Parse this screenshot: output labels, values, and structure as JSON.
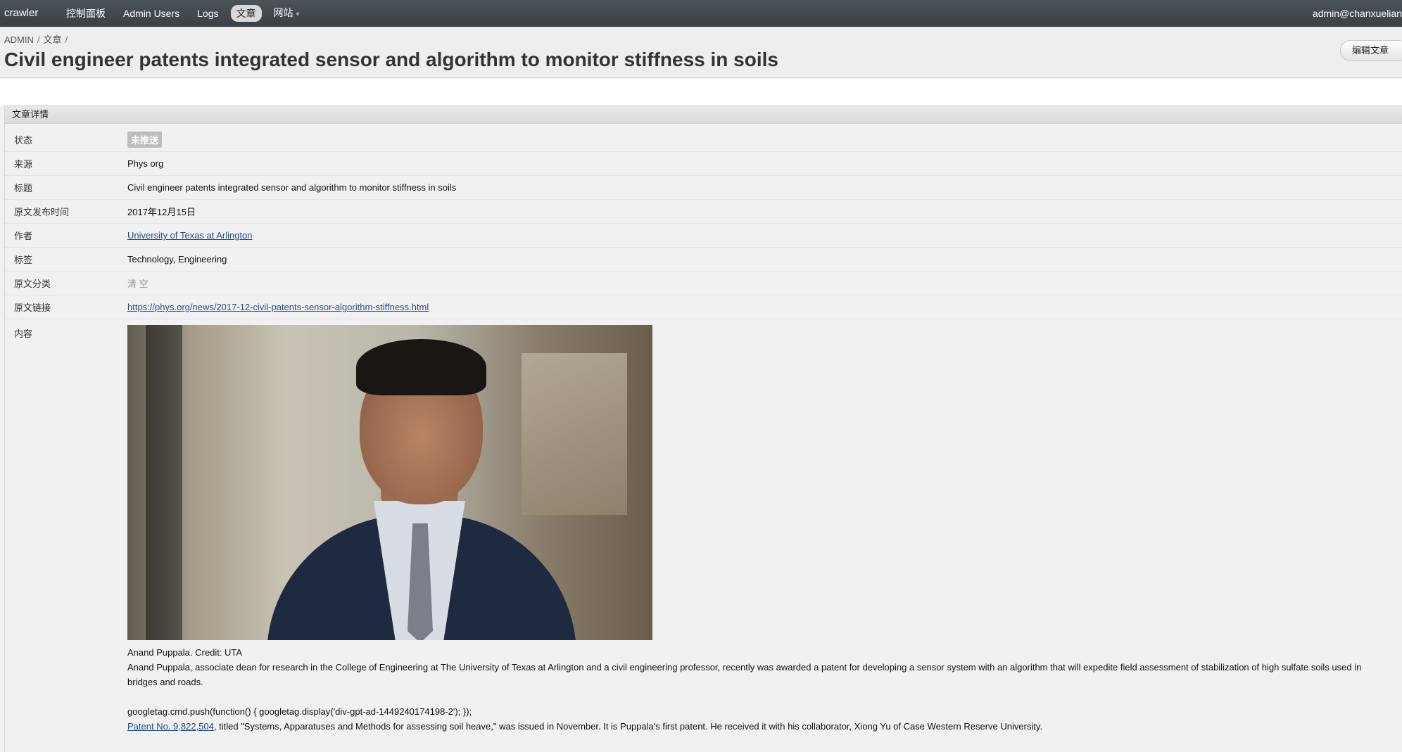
{
  "topbar": {
    "brand": "crawler",
    "nav": [
      {
        "label": "控制面板"
      },
      {
        "label": "Admin Users"
      },
      {
        "label": "Logs"
      },
      {
        "label": "文章"
      },
      {
        "label": "网站"
      }
    ],
    "user": "admin@chanxuelian"
  },
  "header": {
    "breadcrumb": [
      "ADMIN",
      "文章"
    ],
    "title": "Civil engineer patents integrated sensor and algorithm to monitor stiffness in soils",
    "edit_label": "编辑文章"
  },
  "panel": {
    "title": "文章详情",
    "rows": {
      "status": {
        "label": "状态",
        "value": "未推送"
      },
      "source": {
        "label": "来源",
        "value": "Phys org"
      },
      "title": {
        "label": "标题",
        "value": "Civil engineer patents integrated sensor and algorithm to monitor stiffness in soils"
      },
      "published": {
        "label": "原文发布时间",
        "value": "2017年12月15日"
      },
      "author": {
        "label": "作者",
        "value": "University of Texas at Arlington"
      },
      "tags": {
        "label": "标签",
        "value": "Technology, Engineering"
      },
      "category": {
        "label": "原文分类",
        "value": "清 空"
      },
      "link": {
        "label": "原文链接",
        "value": "https://phys.org/news/2017-12-civil-patents-sensor-algorithm-stiffness.html"
      }
    },
    "content": {
      "label": "内容",
      "caption": "Anand Puppala. Credit: UTA",
      "paragraph1_line1": "Anand Puppala, associate dean for research in the College of Engineering at The University of Texas at Arlington and a civil engineering professor, recently was awarded a patent for developing a sensor system with an algorithm that will expedite field assessment of stabilization of high sulfate soils used in",
      "paragraph1_line2": "bridges and roads.",
      "script_line": "googletag.cmd.push(function() { googletag.display('div-gpt-ad-1449240174198-2'); });",
      "patent_link": "Patent No. 9,822,504",
      "patent_text": ", titled \"Systems, Apparatuses and Methods for assessing soil heave,\" was issued in November. It is Puppala's first patent. He received it with his collaborator, Xiong Yu of Case Western Reserve University."
    }
  }
}
